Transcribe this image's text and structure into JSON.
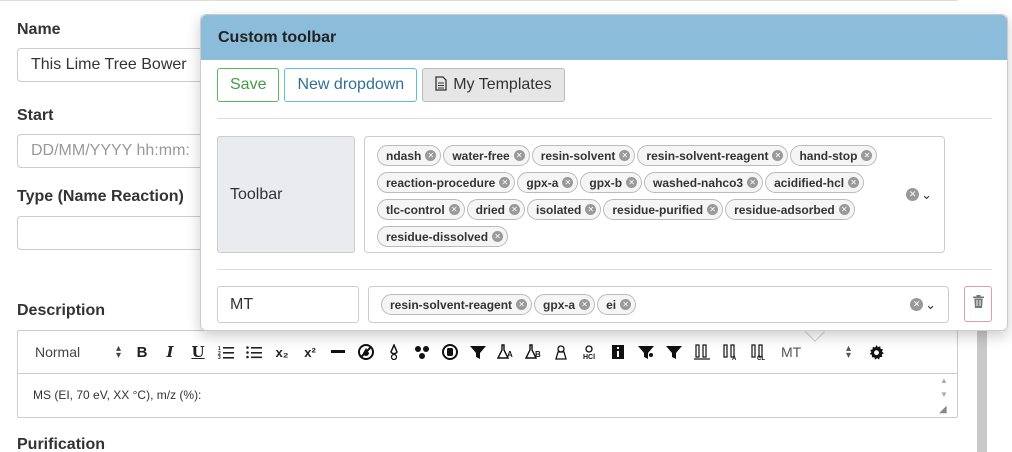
{
  "form": {
    "name_label": "Name",
    "name_value": "This Lime Tree Bower",
    "start_label": "Start",
    "start_placeholder": "DD/MM/YYYY hh:mm:",
    "type_label": "Type (Name Reaction)",
    "description_label": "Description",
    "purification_label": "Purification"
  },
  "editor": {
    "format_select": "Normal",
    "template_select": "MT",
    "body_text": "MS (EI, 70 eV, XX °C), m/z (%):",
    "toolbar_icons": [
      "bold-icon",
      "italic-icon",
      "underline-icon",
      "ordered-list-icon",
      "bullet-list-icon",
      "subscript-icon",
      "superscript-icon",
      "ndash-icon",
      "water-free-icon",
      "resin-solvent-icon",
      "resin-solvent-reagent-icon",
      "hand-stop-icon",
      "reaction-procedure-icon",
      "gpx-a-icon",
      "gpx-b-icon",
      "washed-nahco3-icon",
      "acidified-hcl-icon",
      "tlc-control-icon",
      "dried-icon",
      "isolated-icon",
      "residue-purified-icon",
      "residue-adsorbed-icon",
      "residue-dissolved-icon",
      "settings-gear-icon"
    ],
    "toolbar_glyphs": {
      "bold": "B",
      "italic": "I",
      "underline": "U",
      "ordered_list": "☰",
      "bullet_list": "☰",
      "subscript": "x₂",
      "superscript": "x²"
    }
  },
  "popover": {
    "title": "Custom toolbar",
    "save_label": "Save",
    "new_dropdown_label": "New dropdown",
    "templates_label": "My Templates",
    "toolbar_row": {
      "label": "Toolbar",
      "tags": [
        "ndash",
        "water-free",
        "resin-solvent",
        "resin-solvent-reagent",
        "hand-stop",
        "reaction-procedure",
        "gpx-a",
        "gpx-b",
        "washed-nahco3",
        "acidified-hcl",
        "tlc-control",
        "dried",
        "isolated",
        "residue-purified",
        "residue-adsorbed",
        "residue-dissolved"
      ]
    },
    "dropdown_row": {
      "name": "MT",
      "tags": [
        "resin-solvent-reagent",
        "gpx-a",
        "ei"
      ]
    }
  },
  "colors": {
    "header_bg": "#8bbcd9",
    "save_green": "#5cb85c",
    "info_blue": "#5bc0de",
    "danger_red": "#d9534f"
  }
}
